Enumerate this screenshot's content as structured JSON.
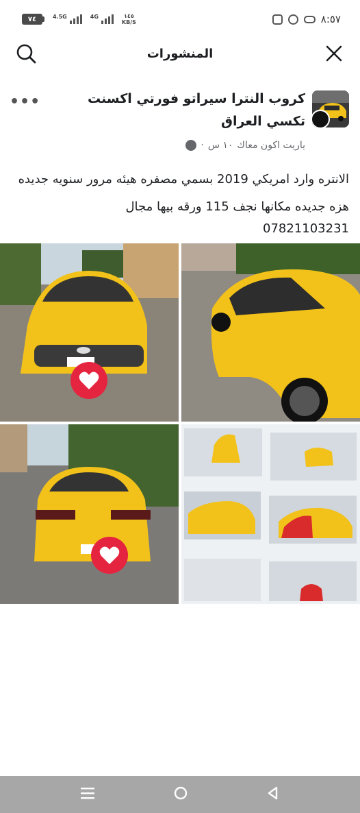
{
  "status_bar": {
    "battery": "٧٤",
    "signal_1_label": "4.5G",
    "signal_2_label": "4G",
    "net_speed_value": "١٤٥",
    "net_speed_unit": "KB/S",
    "time": "٨:٥٧",
    "icons": [
      "instagram-icon",
      "whatsapp-icon",
      "gamepad-icon"
    ]
  },
  "header": {
    "title": "المنشورات"
  },
  "post": {
    "group_name": "كروب النترا سيراتو فورتي اكسنت تكسي العراق",
    "author": "ياريت اكون معاك",
    "time": "١٠ س",
    "separator": "·",
    "text": "الانتره وارد امريكي 2019 بسمي مصفره هيئه مرور سنويه جديده هزه جديده مكانها نجف 115 ورقه بيها مجال",
    "phone": "07821103231",
    "more_label": "•••"
  },
  "photos": [
    {
      "name": "front-view"
    },
    {
      "name": "side-view"
    },
    {
      "name": "rear-view"
    },
    {
      "name": "inspection-report"
    }
  ],
  "colors": {
    "taxi_yellow": "#f2c21a",
    "heart_red": "#e5243f",
    "nav_gray": "#a7a7a7"
  }
}
